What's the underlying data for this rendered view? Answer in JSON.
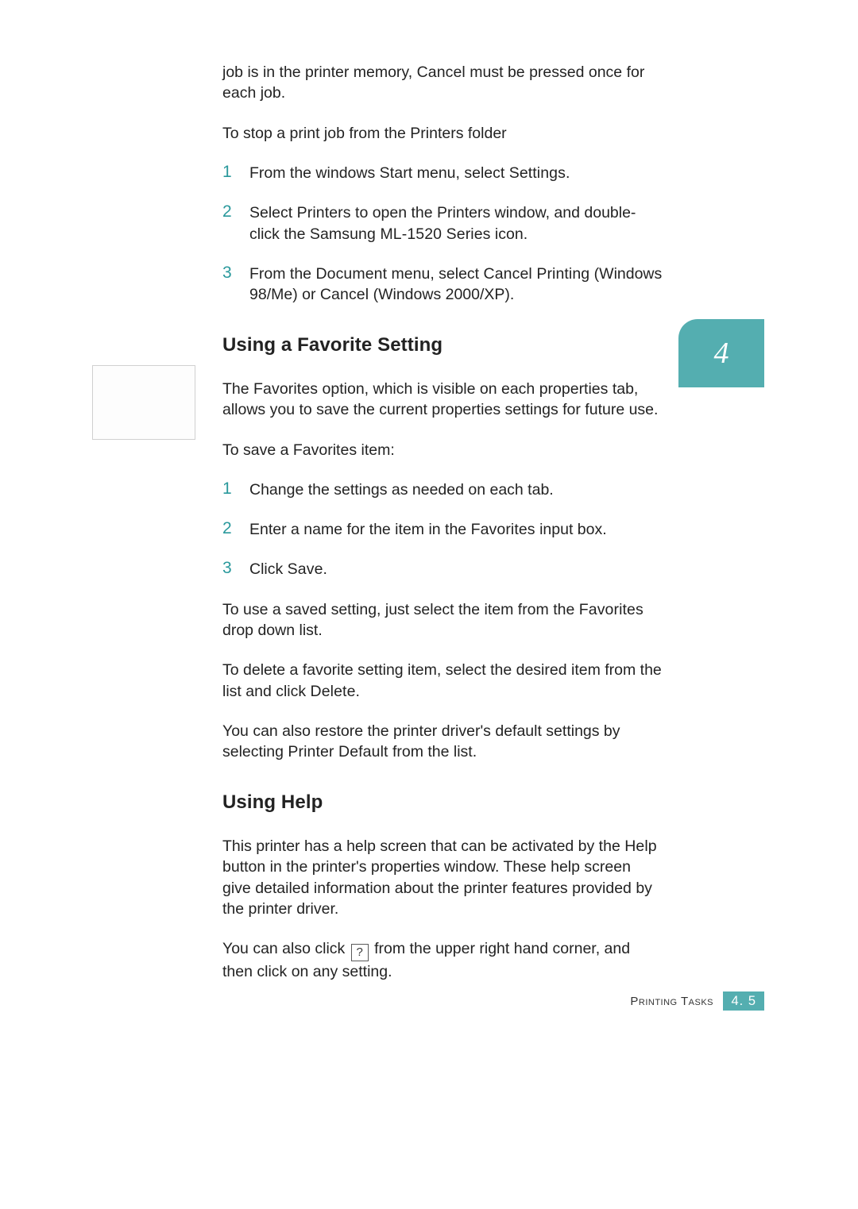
{
  "colors": {
    "accent": "#54aeb0",
    "stepNumber": "#2a999c",
    "text": "#222222"
  },
  "sideTab": {
    "chapter": "4"
  },
  "intro": {
    "part1": "job is in the printer memory, ",
    "cancel": "Cancel",
    "part2": " must be pressed once for each job."
  },
  "stopJob": {
    "heading": "To stop a print job from the Printers folder",
    "steps": [
      {
        "num": "1",
        "a": "From the windows ",
        "start": "Start",
        "b": " menu, select ",
        "settings": "Settings",
        "c": "."
      },
      {
        "num": "2",
        "a": "Select ",
        "printers": "Printers",
        "b": " to open the Printers window, and double-click the ",
        "driver": "Samsung ML-1520 Series",
        "c": " icon."
      },
      {
        "num": "3",
        "a": "From the ",
        "document": "Document",
        "b": " menu, select ",
        "cancelPrinting": "Cancel Printing",
        "c": " (Windows 98/Me) or ",
        "cancel": "Cancel",
        "d": " (Windows 2000/XP)."
      }
    ]
  },
  "favorite": {
    "heading": "Using a Favorite Setting",
    "para1": {
      "a": "The ",
      "favorites": "Favorites",
      "b": " option, which is visible on each properties tab, allows you to save the current properties settings for future use."
    },
    "saveHeading": "To save a Favorites item:",
    "steps": [
      {
        "num": "1",
        "a": "Change the settings as needed on each tab."
      },
      {
        "num": "2",
        "a": "Enter a name for the item in the ",
        "favorites": "Favorites",
        "b": " input box."
      },
      {
        "num": "3",
        "a": "Click ",
        "save": "Save",
        "b": "."
      }
    ],
    "use": {
      "a": "To use a saved setting, just select the item from the ",
      "favorites": "Favorites",
      "b": " drop down list."
    },
    "delete": {
      "a": "To delete a favorite setting item, select the desired item from the list and click ",
      "delete": "Delete",
      "b": "."
    },
    "restore": {
      "a": "You can also restore the printer driver's default settings by selecting ",
      "printerDefault": "Printer Default",
      "b": " from the list."
    }
  },
  "help": {
    "heading": "Using Help",
    "para1": {
      "a": "This printer has a help screen that can be activated by the ",
      "helpBtn": "Help",
      "b": " button in the printer's properties window. These help screen give detailed information about the printer features provided by the printer driver."
    },
    "para2": {
      "a": "You can also click ",
      "iconGlyph": "?",
      "b": " from the upper right hand corner, and then click on any setting."
    }
  },
  "footer": {
    "label": "Printing Tasks",
    "page": "4. 5"
  }
}
